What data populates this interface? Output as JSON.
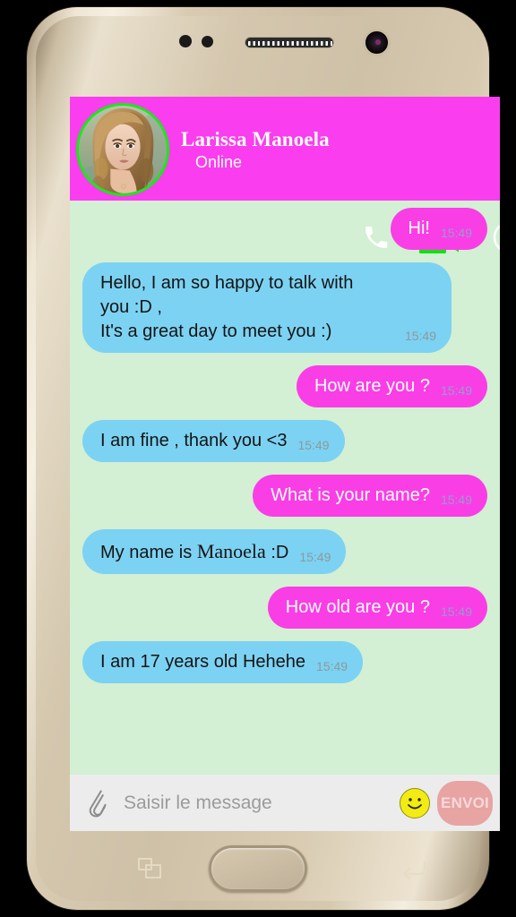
{
  "device": {
    "frame_color": "#D4C7AE",
    "hardware": {
      "front_camera": "front-camera",
      "speaker": "earpiece-speaker",
      "sensors": "proximity-sensors",
      "home": "home-button",
      "recents": "recents-button",
      "back": "back-button"
    }
  },
  "header": {
    "name": "Larissa Manoela",
    "status": "Online",
    "background_color": "#FA3DEE",
    "avatar_border_color": "#1AE81A",
    "video_icon_color": "#1AE81A",
    "actions": [
      {
        "name": "call-button",
        "icon": "phone-icon",
        "color": "#FFFFFF"
      },
      {
        "name": "video-call-button",
        "icon": "video-camera-icon",
        "color": "#1AE81A"
      },
      {
        "name": "info-button",
        "icon": "info-circle-icon",
        "color": "#FFFFFF"
      }
    ]
  },
  "chat": {
    "background_color": "#D3EFD4",
    "incoming_bubble_color": "#7CD2F2",
    "outgoing_bubble_color": "#F93EE6",
    "messages": [
      {
        "side": "out",
        "text": "Hi!",
        "time": "15:49"
      },
      {
        "side": "in",
        "text": "Hello, I am so happy to talk with you :D ,\nIt's a great day to meet you :)",
        "time": "15:49",
        "multiline": true
      },
      {
        "side": "out",
        "text": "How are you ?",
        "time": "15:49"
      },
      {
        "side": "in",
        "text": "I am fine , thank you <3",
        "time": "15:49"
      },
      {
        "side": "out",
        "text": "What is your name?",
        "time": "15:49"
      },
      {
        "side": "in",
        "text": "My name is  Manoela  :D",
        "time": "15:49",
        "serif_part": "Manoela",
        "prefix": "My name is  ",
        "suffix": "  :D"
      },
      {
        "side": "out",
        "text": "How old are you ?",
        "time": "15:49"
      },
      {
        "side": "in",
        "text": "I am 17 years old Hehehe",
        "time": "15:49"
      }
    ]
  },
  "input_bar": {
    "background_color": "#ECECEC",
    "attach_icon": "paperclip-icon",
    "placeholder": "Saisir le message",
    "value": "",
    "emoji_icon": "smiley-face-icon",
    "emoji_color": "#F2EC14",
    "send_label": "ENVOI",
    "send_color": "#E8A3A3"
  }
}
